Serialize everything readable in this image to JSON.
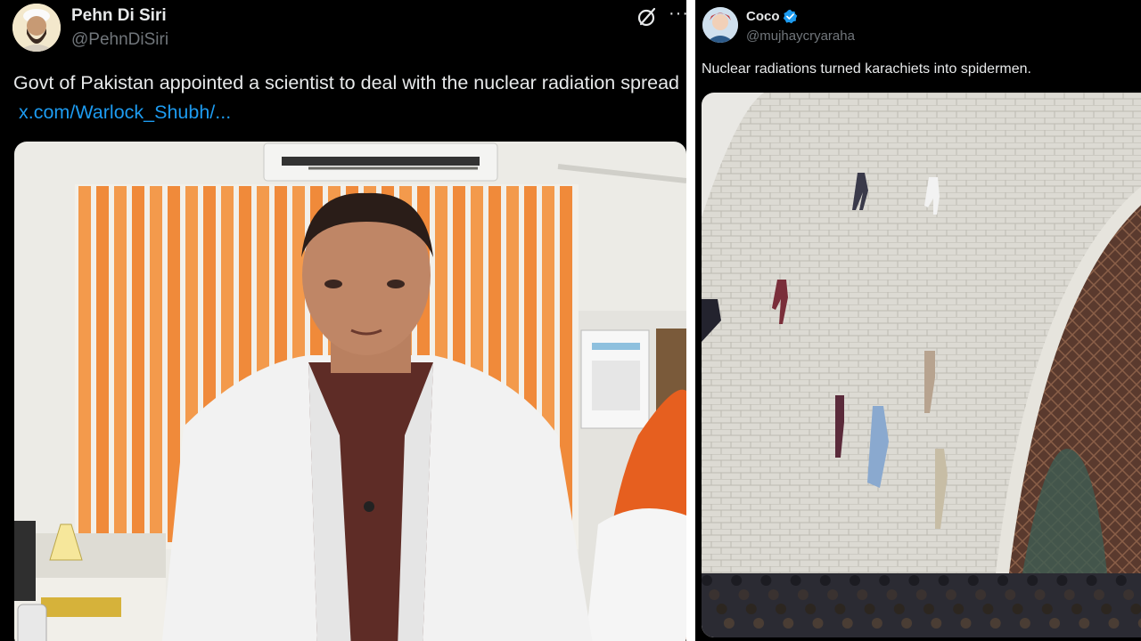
{
  "left_post": {
    "author_name": "Pehn Di Siri",
    "author_handle": "@PehnDiSiri",
    "text": "Govt of Pakistan appointed a scientist to deal with the nuclear radiation spread",
    "link_text": "x.com/Warlock_Shubh/...",
    "more_label": "···",
    "grok_icon": "grok-icon",
    "media_description_icon": "video-still"
  },
  "right_post": {
    "author_name": "Coco",
    "author_handle": "@mujhaycryaraha",
    "verified_icon": "verified-badge-icon",
    "text": "Nuclear radiations turned karachiets into spidermen.",
    "media_icon": "photo"
  },
  "colors": {
    "background": "#000000",
    "text_primary": "#e7e9ea",
    "text_secondary": "#71767b",
    "link": "#1d9bf0",
    "divider": "#ffffff"
  }
}
